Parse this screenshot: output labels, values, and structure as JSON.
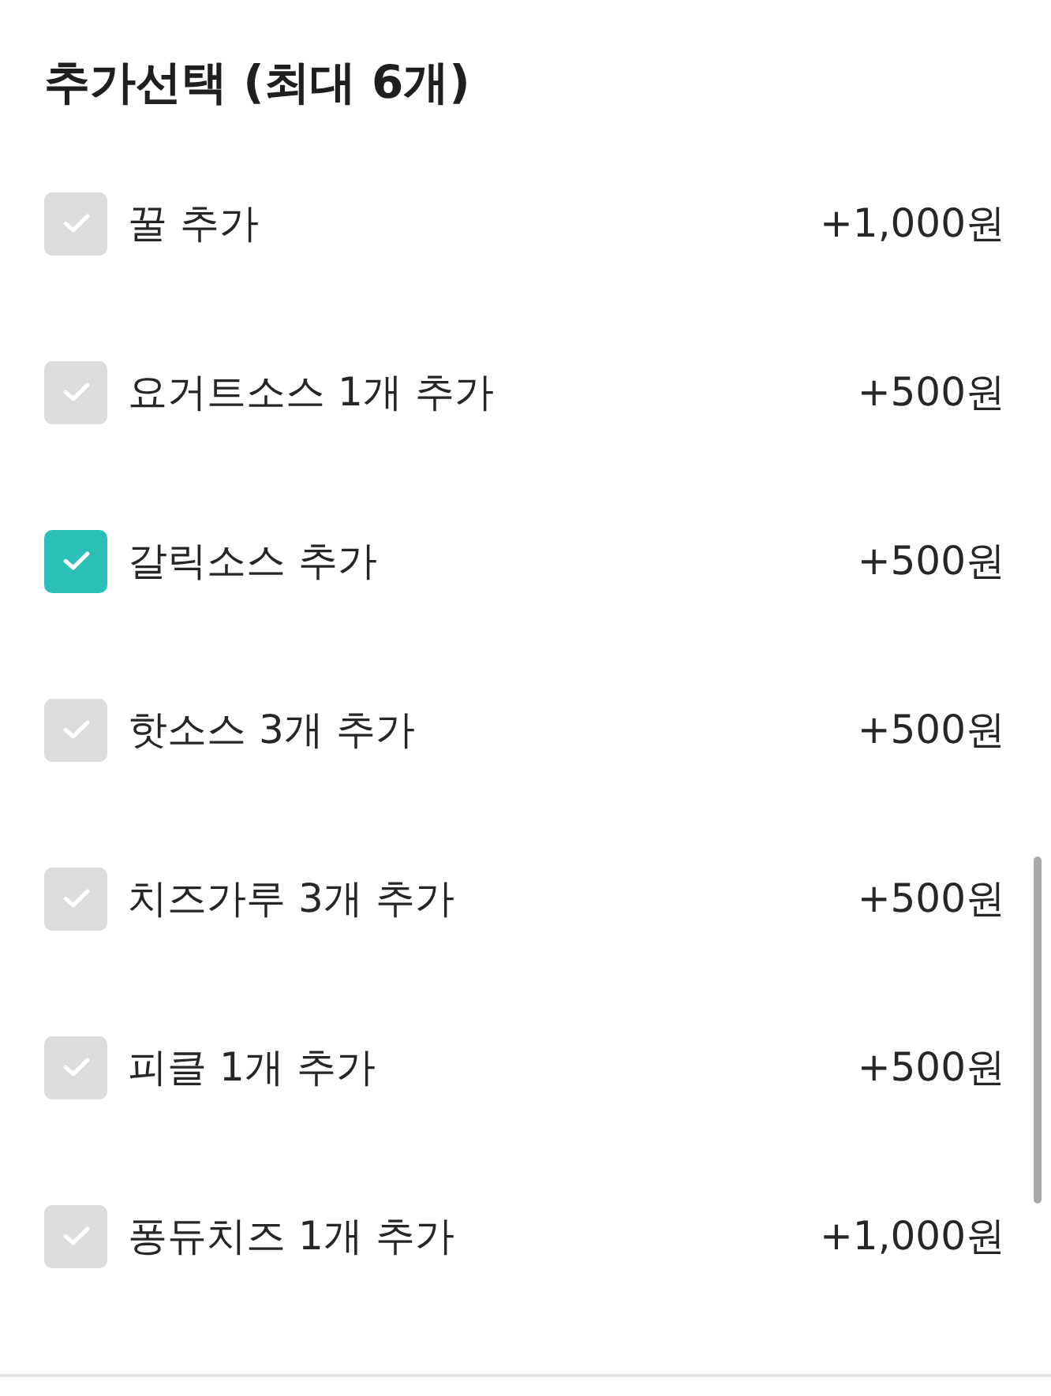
{
  "section": {
    "title": "추가선택 (최대 6개)"
  },
  "options": [
    {
      "label": "꿀 추가",
      "price": "+1,000원",
      "checked": false
    },
    {
      "label": "요거트소스 1개 추가",
      "price": "+500원",
      "checked": false
    },
    {
      "label": "갈릭소스 추가",
      "price": "+500원",
      "checked": true
    },
    {
      "label": "핫소스 3개 추가",
      "price": "+500원",
      "checked": false
    },
    {
      "label": "치즈가루 3개 추가",
      "price": "+500원",
      "checked": false
    },
    {
      "label": "피클 1개 추가",
      "price": "+500원",
      "checked": false
    },
    {
      "label": "퐁듀치즈 1개 추가",
      "price": "+1,000원",
      "checked": false
    }
  ]
}
